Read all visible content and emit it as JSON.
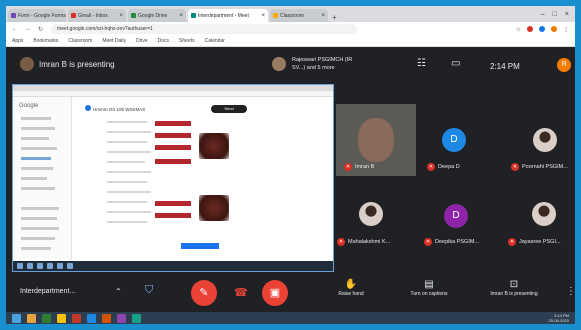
{
  "browser": {
    "tabs": [
      {
        "label": "Form - Google Forms",
        "icon_color": "#7248b9"
      },
      {
        "label": "Gmail - Inbox",
        "icon_color": "#d93025"
      },
      {
        "label": "Google Drive",
        "icon_color": "#1e8e3e"
      },
      {
        "label": "Interdepartment - Meet",
        "icon_color": "#00897b",
        "active": true
      },
      {
        "label": "Classroom",
        "icon_color": "#f9ab00"
      }
    ],
    "url": "meet.google.com/xzi-hqhx-zev?authuser=1",
    "bookmarks": [
      "Apps",
      "Bookmarks",
      "Classroom",
      "Meet Daily",
      "Drive",
      "Docs",
      "Sheets",
      "Calendar"
    ]
  },
  "meet": {
    "presenter_text": "Imran B is presenting",
    "pinned_text": "Rajeswari PSGIMCH (IR SV...) and 5 more",
    "time": "2:14 PM",
    "self_initial": "R",
    "meeting_name": "Interdepartment...",
    "participants": [
      {
        "name": "Imran B"
      },
      {
        "name": "Deepa D",
        "initial": "D",
        "color": "#1e88e5"
      },
      {
        "name": "Poornahi PSGIM..."
      },
      {
        "name": "Mahalakshmi K..."
      },
      {
        "name": "Deepika PSGIM...",
        "initial": "D",
        "color": "#8e24aa"
      },
      {
        "name": "Jayasree PSGI..."
      }
    ],
    "controls": {
      "raise_hand": "Raise hand",
      "captions": "Turn on captions",
      "presenting": "Imran B is presenting"
    }
  },
  "shared_screen": {
    "app_name": "Google",
    "doc_title": "Hmmm OS 105 WXKMAX",
    "share_button": "Send"
  },
  "system": {
    "time": "2:14 PM",
    "date": "25-09-2020"
  }
}
